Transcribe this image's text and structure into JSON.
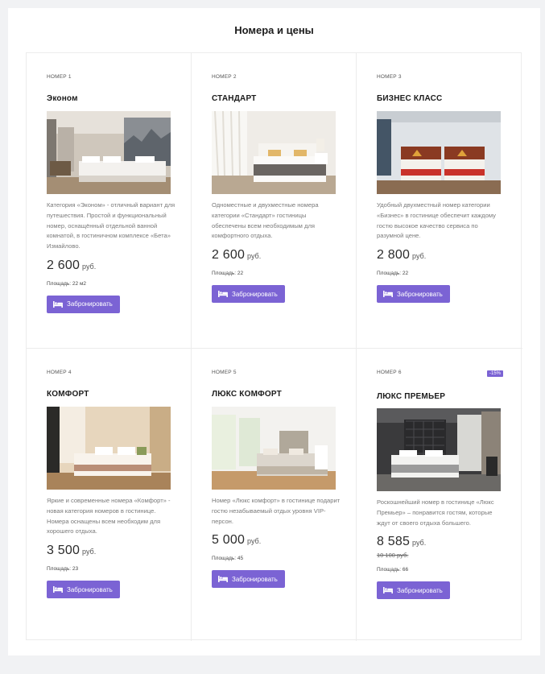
{
  "section": {
    "title": "Номера и цены"
  },
  "colors": {
    "accent": "#7b63d4",
    "discount_badge": "#7b63d4"
  },
  "rooms": [
    {
      "number": "Номер 1",
      "title": "Эконом",
      "description": "Категория «Эконом» - отличный вариант для путешествия. Простой и функциональный номер, оснащённый отдельной ванной комнатой, в гостиничном комплексе «Бета» Измайлово.",
      "price": "2 600",
      "currency": "руб.",
      "area": "Площадь: 22 м2",
      "button": "Забронировать",
      "icon": "bed-icon"
    },
    {
      "number": "Номер 2",
      "title": "СТАНДАРТ",
      "description": "Одноместные и двухместные номера категории «Стандарт» гостиницы обеспечены всем необходимым для комфортного отдыха.",
      "price": "2 600",
      "currency": "руб.",
      "area": "Площадь: 22",
      "button": "Забронировать",
      "icon": "bed-icon"
    },
    {
      "number": "Номер 3",
      "title": "БИЗНЕС КЛАСС",
      "description": "Удобный двухместный номер категории «Бизнес» в гостинице обеспечит каждому гостю высокое качество сервиса по разумной цене.",
      "price": "2 800",
      "currency": "руб.",
      "area": "Площадь: 22",
      "button": "Забронировать",
      "icon": "bed-icon"
    },
    {
      "number": "Номер 4",
      "title": "КОМФОРТ",
      "description": "Яркие и современные номера «Комфорт» - новая категория номеров в гостинице. Номера оснащены всем необходим для хорошего отдыха.",
      "price": "3 500",
      "currency": "руб.",
      "area": "Площадь: 23",
      "button": "Забронировать",
      "icon": "bed-icon"
    },
    {
      "number": "Номер 5",
      "title": "ЛЮКС КОМФОРТ",
      "description": "Номер «Люкс комфорт» в гостинице подарит гостю незабываемый отдых уровня VIP-персон.",
      "price": "5 000",
      "currency": "руб.",
      "area": "Площадь: 45",
      "button": "Забронировать",
      "icon": "bed-icon"
    },
    {
      "number": "Номер 6",
      "title": "ЛЮКС ПРЕМЬЕР",
      "discount": "-15%",
      "description": "Роскошнейший номер в гостинице «Люкс Премьер» – понравится гостям, которые ждут от своего отдыха большего.",
      "price": "8 585",
      "currency": "руб.",
      "old_price": "10 100 руб.",
      "area": "Площадь: 66",
      "button": "Забронировать",
      "icon": "bed-icon"
    }
  ]
}
